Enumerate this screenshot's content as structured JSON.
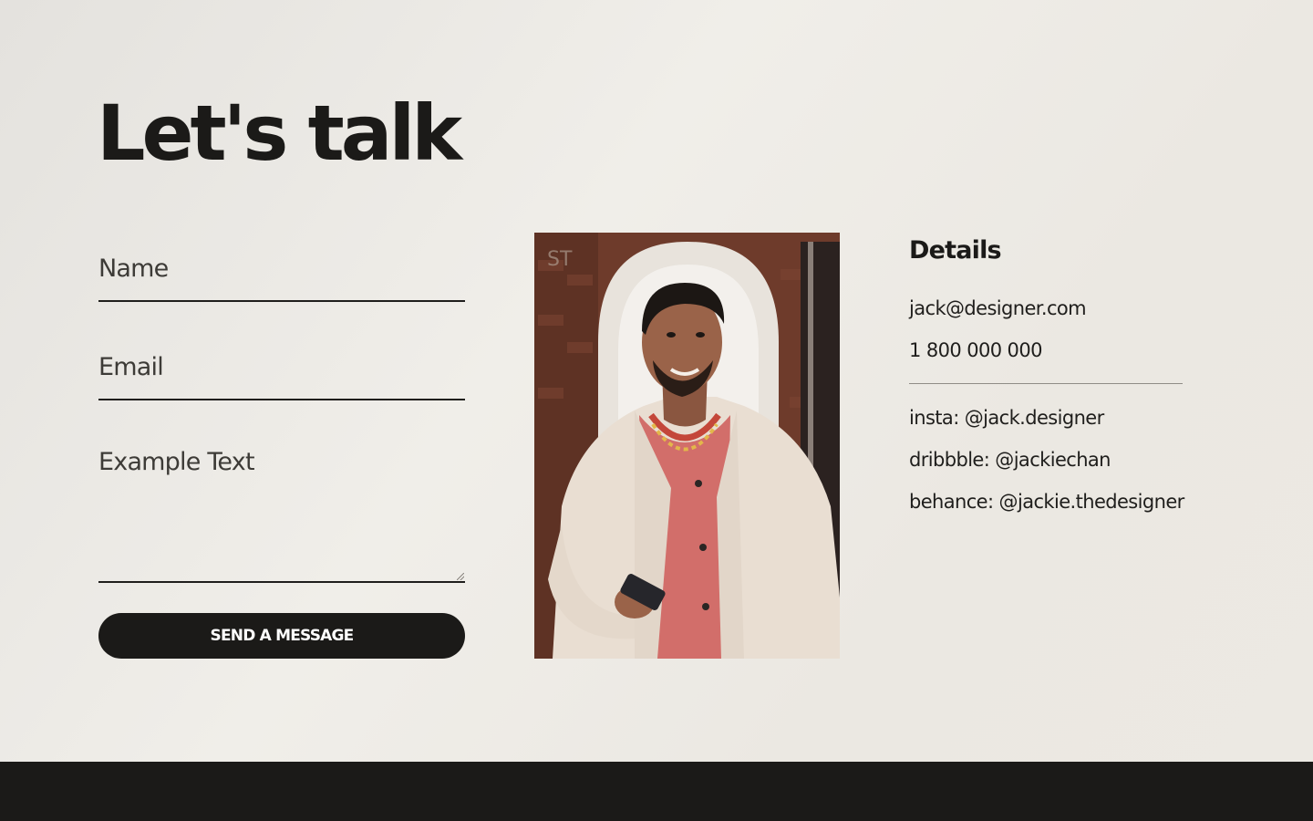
{
  "header": {
    "title": "Let's talk"
  },
  "form": {
    "name_placeholder": "Name",
    "email_placeholder": "Email",
    "message_placeholder": "Example Text",
    "submit_label": "SEND A MESSAGE"
  },
  "portrait": {
    "alt": "Portrait of a smiling man in a cream jacket and pink shirt holding a phone"
  },
  "details": {
    "title": "Details",
    "email": "jack@designer.com",
    "phone": "1 800 000 000",
    "socials": [
      {
        "label": "insta: @jack.designer"
      },
      {
        "label": "dribbble: @jackiechan"
      },
      {
        "label": "behance: @jackie.thedesigner"
      }
    ]
  },
  "colors": {
    "background": "#ece9e3",
    "text": "#1b1a18",
    "button": "#1b1a18",
    "footer": "#1b1a18"
  }
}
